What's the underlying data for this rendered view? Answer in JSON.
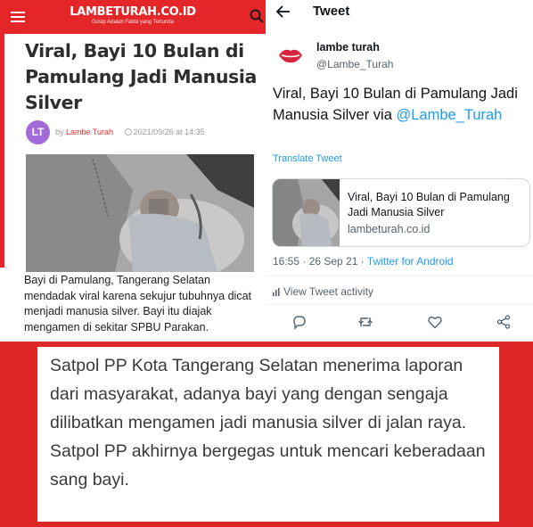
{
  "article": {
    "site_logo": "LAMBETURAH.CO.ID",
    "site_tagline": "Gosip Adalah Fakta yang Tertunda",
    "title": "Viral, Bayi 10 Bulan di Pamulang Jadi Manusia Silver",
    "author_initials": "LT",
    "byline_prefix": "by",
    "author": "Lambe Turah",
    "date": "2021/09/26 at 14:35",
    "body": "Bayi di Pamulang, Tangerang Selatan mendadak viral karena sekujur tubuhnya dicat menjadi manusia silver. Bayi itu diajak mengamen di sekitar SPBU Parakan."
  },
  "tweet": {
    "topbar_title": "Tweet",
    "display_name": "lambe turah",
    "handle": "@Lambe_Turah",
    "text": "Viral, Bayi 10 Bulan di Pamulang Jadi Manusia Silver via",
    "mention": "@Lambe_Turah",
    "translate": "Translate Tweet",
    "card_title": "Viral, Bayi 10 Bulan di Pamulang Jadi Manusia Silver",
    "card_domain": "lambeturah.co.id",
    "timestamp": "16:55 · 26 Sep 21 · ",
    "app": "Twitter for Android",
    "activity": "View Tweet activity"
  },
  "quote": {
    "text": "Satpol PP Kota Tangerang Selatan menerima laporan dari masyarakat, adanya bayi yang dengan sengaja dilibatkan mengamen jadi manusia silver di jalan raya. Satpol PP akhirnya bergegas untuk mencari keberadaan sang bayi."
  },
  "colors": {
    "brand_red": "#e52629",
    "twitter_blue": "#1d9bf0",
    "avatar_purple": "#a26bd7"
  },
  "icons": [
    "menu-icon",
    "search-icon",
    "clock-icon",
    "back-arrow-icon",
    "lips-logo-icon",
    "bar-chart-icon",
    "reply-icon",
    "retweet-icon",
    "like-icon",
    "share-icon"
  ]
}
